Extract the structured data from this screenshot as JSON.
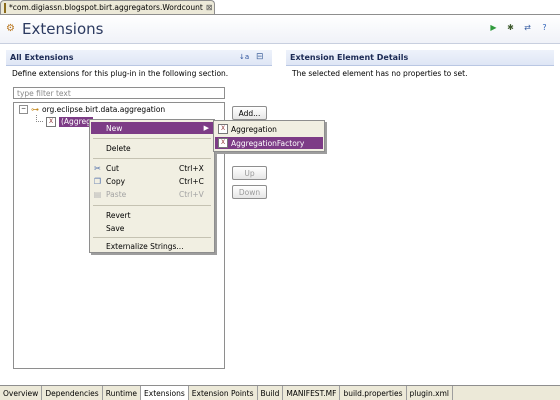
{
  "editor_tab": {
    "title": "*com.digiassn.blogspot.birt.aggregators.Wordcount",
    "close": "⊠"
  },
  "page": {
    "title": "Extensions"
  },
  "header_toolbar": [
    {
      "name": "run-icon",
      "glyph": "▶",
      "color": "#2f9a3c"
    },
    {
      "name": "debug-icon",
      "glyph": "✱",
      "color": "#3e5a2e"
    },
    {
      "name": "export-icon",
      "glyph": "⇄",
      "color": "#3a5fa4"
    },
    {
      "name": "help-icon",
      "glyph": "?",
      "color": "#2a5fb8"
    }
  ],
  "left_section": {
    "title": "All Extensions",
    "description": "Define extensions for this plug-in in the following section.",
    "filter_placeholder": "type filter text",
    "sort_icon": "↓a",
    "collapse_icon": "⊟",
    "tree": {
      "root_label": "org.eclipse.birt.data.aggregation",
      "root_expander": "−",
      "child_label": "(Aggreg"
    },
    "buttons": {
      "add": "Add...",
      "up": "Up",
      "down": "Down"
    }
  },
  "right_section": {
    "title": "Extension Element Details",
    "description": "The selected element has no properties to set."
  },
  "context_menu": {
    "new": "New",
    "delete": "Delete",
    "cut": "Cut",
    "cut_accel": "Ctrl+X",
    "copy": "Copy",
    "copy_accel": "Ctrl+C",
    "paste": "Paste",
    "paste_accel": "Ctrl+V",
    "revert": "Revert",
    "save": "Save",
    "externalize": "Externalize Strings..."
  },
  "submenu": {
    "items": [
      "Aggregation",
      "AggregationFactory"
    ],
    "icon_letter": "X"
  },
  "bottom_tabs": [
    "Overview",
    "Dependencies",
    "Runtime",
    "Extensions",
    "Extension Points",
    "Build",
    "MANIFEST.MF",
    "build.properties",
    "plugin.xml"
  ],
  "active_bottom_tab": "Extensions",
  "colors": {
    "selection": "#7d3c86",
    "title_text": "#2c3a60",
    "section_title": "#1b2a55"
  }
}
